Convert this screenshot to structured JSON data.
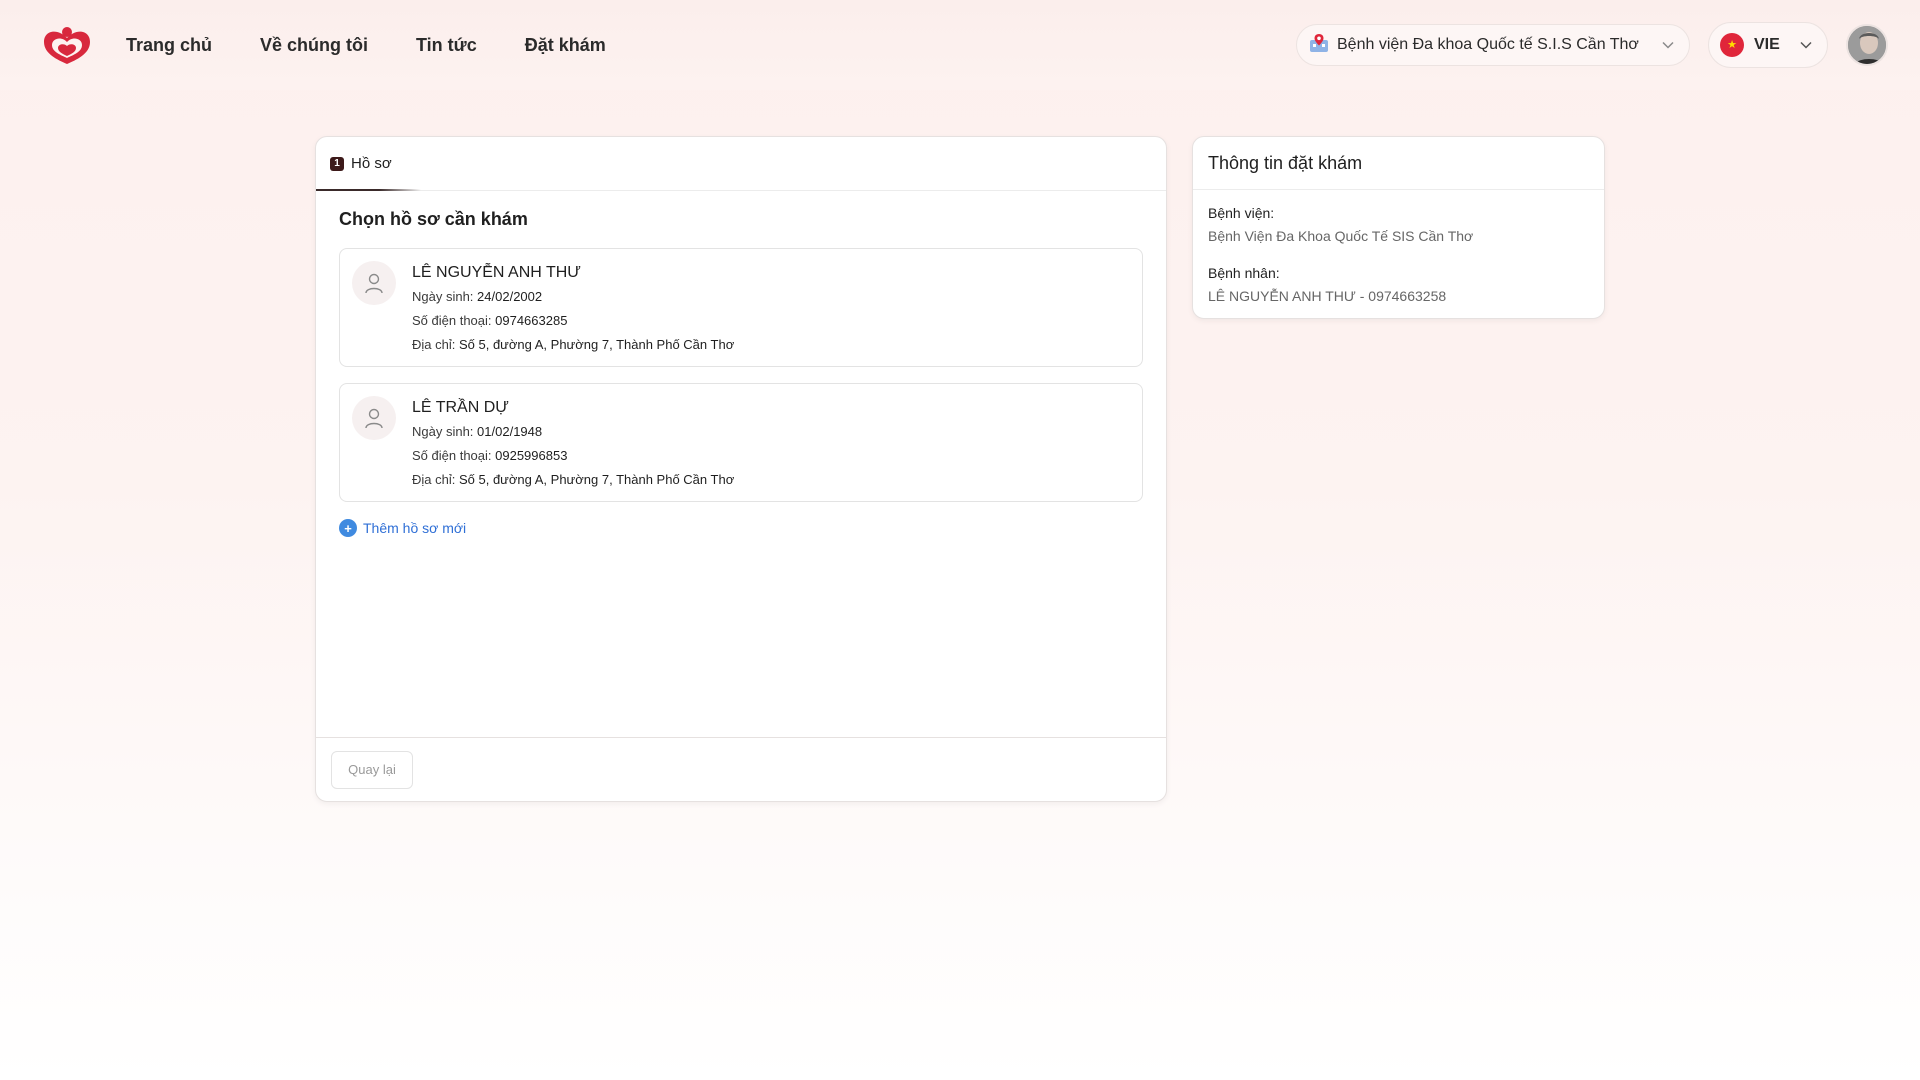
{
  "header": {
    "nav": [
      {
        "label": "Trang chủ"
      },
      {
        "label": "Về chúng tôi"
      },
      {
        "label": "Tin tức"
      },
      {
        "label": "Đặt khám"
      }
    ],
    "hospital_select": {
      "value": "Bệnh viện Đa khoa Quốc tế S.I.S Cần Thơ",
      "icon": "hospital-pin-icon"
    },
    "language_select": {
      "value": "VIE",
      "icon": "vietnam-flag-icon"
    },
    "avatar": {
      "icon": "user-avatar"
    }
  },
  "main": {
    "tab": {
      "step": "1",
      "label": "Hồ sơ"
    },
    "section_title": "Chọn hồ sơ cần khám",
    "profiles": [
      {
        "name": "LÊ NGUYỄN ANH THƯ",
        "dob_label": "Ngày sinh:",
        "dob": "24/02/2002",
        "phone_label": "Số điện thoại:",
        "phone": "0974663285",
        "address_label": "Địa chỉ:",
        "address": "Số 5, đường A, Phường 7, Thành Phố Cần Thơ"
      },
      {
        "name": "LÊ TRẦN DỰ",
        "dob_label": "Ngày sinh:",
        "dob": "01/02/1948",
        "phone_label": "Số điện thoại:",
        "phone": "0925996853",
        "address_label": "Địa chỉ:",
        "address": "Số 5, đường A, Phường 7, Thành Phố Cần Thơ"
      }
    ],
    "add_profile_label": "Thêm hồ sơ mới",
    "back_label": "Quay lại"
  },
  "summary": {
    "title": "Thông tin đặt khám",
    "hospital_label": "Bệnh viện:",
    "hospital_value": "Bệnh Viện Đa Khoa Quốc Tế SIS Cần Thơ",
    "patient_label": "Bệnh nhân:",
    "patient_value": "LÊ NGUYỄN ANH THƯ - 0974663258"
  },
  "colors": {
    "brand": "#d8283d",
    "link": "#2f6fd6",
    "background": "#fdf0ee"
  }
}
